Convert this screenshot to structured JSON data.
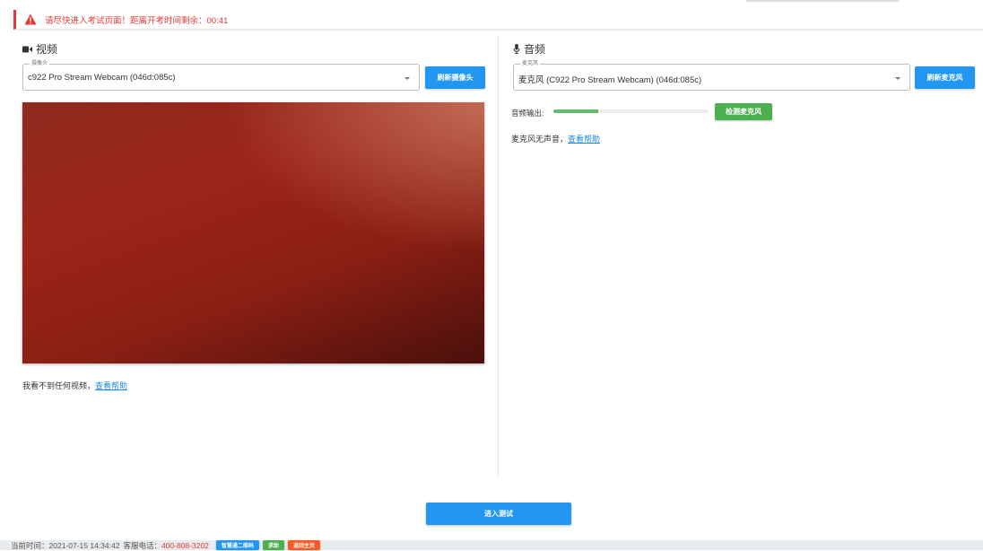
{
  "alert": {
    "text": "请尽快进入考试页面！距离开考时间剩余：00:41",
    "color": "#e53935"
  },
  "video": {
    "section_title": "视频",
    "icon": "video-camera-icon",
    "field_label": "摄像头",
    "selected_camera": "c922 Pro Stream Webcam (046d:085c)",
    "refresh_button": "刷新摄像头",
    "help_text": "我看不到任何视频，",
    "help_link": "查看帮助"
  },
  "audio": {
    "section_title": "音频",
    "icon": "microphone-icon",
    "field_label": "麦克风",
    "selected_mic": "麦克风 (C922 Pro Stream Webcam) (046d:085c)",
    "refresh_button": "刷新麦克风",
    "output_label": "音频输出:",
    "output_level": 0.29,
    "test_button": "检测麦克风",
    "help_text": "麦克风无声音，",
    "help_link": "查看帮助"
  },
  "enter_button": "进入测试",
  "footer": {
    "time_label": "当前时间：",
    "time": "2021-07-15 14:34:42",
    "service_label": "客服电话：",
    "phone": "400-808-3202",
    "buttons": [
      "智慧通二维码",
      "求助",
      "返回主页"
    ]
  },
  "colors": {
    "primary": "#2196f3",
    "success": "#4caf50",
    "warning": "#ff5722",
    "danger": "#e53935",
    "link": "#1e88e5"
  }
}
